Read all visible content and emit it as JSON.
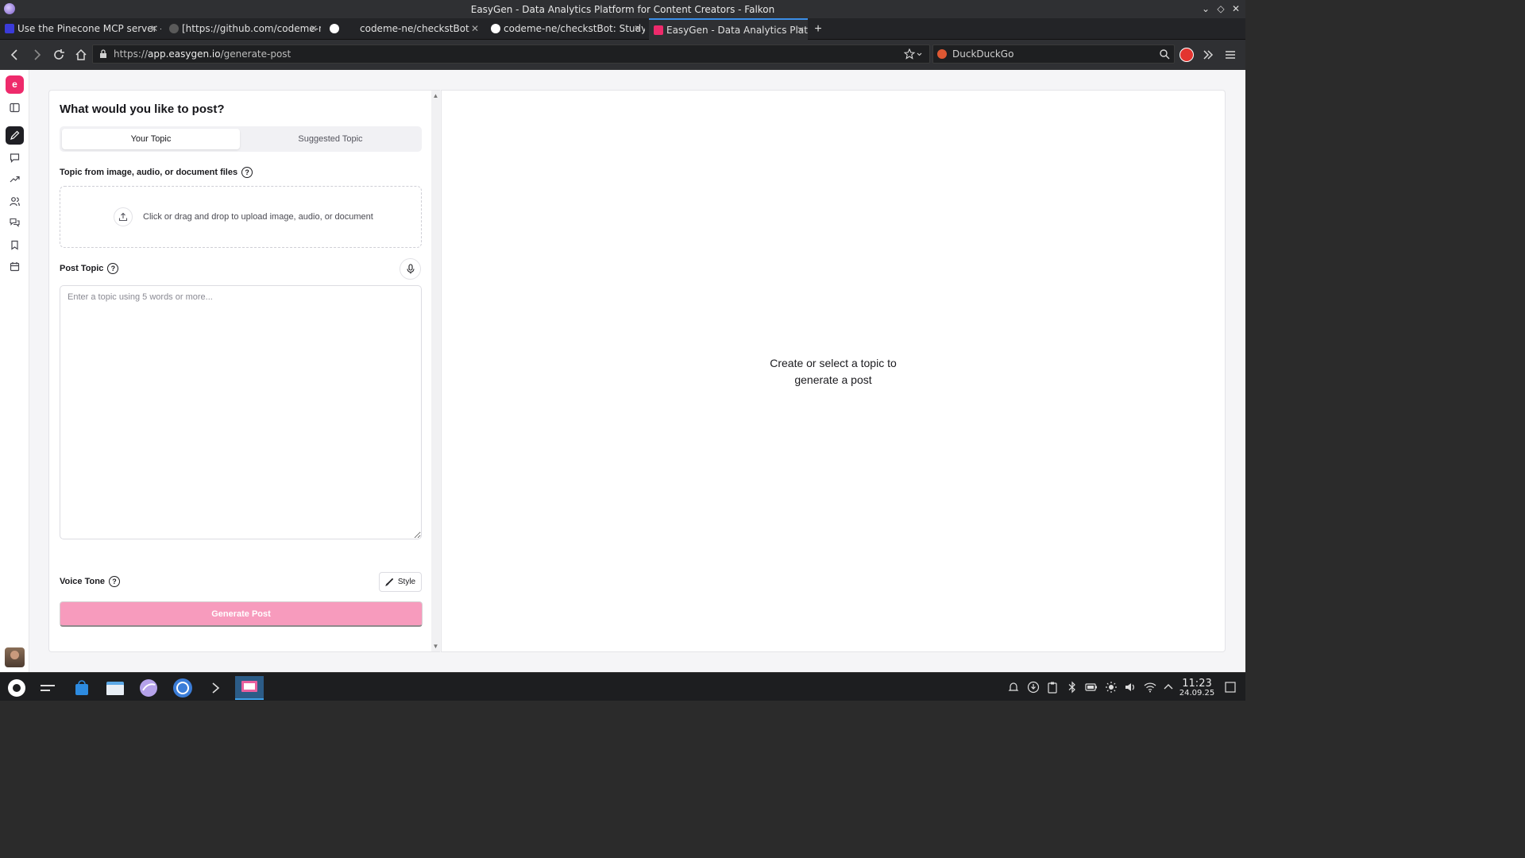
{
  "window": {
    "title": "EasyGen - Data Analytics Platform for Content Creators - Falkon"
  },
  "tabs": [
    {
      "label": "Use the Pinecone MCP server -...",
      "favicon_color": "#3b3bd9"
    },
    {
      "label": "[https://github.com/codeme-n...",
      "favicon_color": "#cccccc"
    },
    {
      "label": "",
      "favicon_color": "#ffffff"
    },
    {
      "label": "codeme-ne/checkstBot",
      "favicon_color": ""
    },
    {
      "label": "codeme-ne/checkstBot: Study ...",
      "favicon_color": "#ffffff"
    },
    {
      "label": "EasyGen - Data Analytics Platf...",
      "favicon_color": "#ee2a6b"
    }
  ],
  "navbar": {
    "url_scheme": "https://",
    "url_host": "app.easygen.io",
    "url_path": "/generate-post",
    "search_engine": "DuckDuckGo"
  },
  "app": {
    "brand_letter": "e",
    "accent_color": "#ee2a6b",
    "rail_icons": [
      "sidebar-toggle-icon",
      "pen-icon",
      "message-icon",
      "trending-icon",
      "users-icon",
      "chats-icon",
      "bookmark-icon",
      "calendar-icon"
    ],
    "form": {
      "heading": "What would you like to post?",
      "toggle": {
        "your_topic": "Your Topic",
        "suggested_topic": "Suggested Topic"
      },
      "upload_label": "Topic from image, audio, or document files",
      "upload_text": "Click or drag and drop to upload image, audio, or document",
      "post_topic_label": "Post Topic",
      "post_topic_placeholder": "Enter a topic using 5 words or more...",
      "voice_tone_label": "Voice Tone",
      "style_button": "Style",
      "generate_button": "Generate Post",
      "help_glyph": "?"
    },
    "preview": {
      "empty_line1": "Create or select a topic to",
      "empty_line2": "generate a post"
    }
  },
  "taskbar": {
    "time": "11:23",
    "date": "24.09.25"
  }
}
